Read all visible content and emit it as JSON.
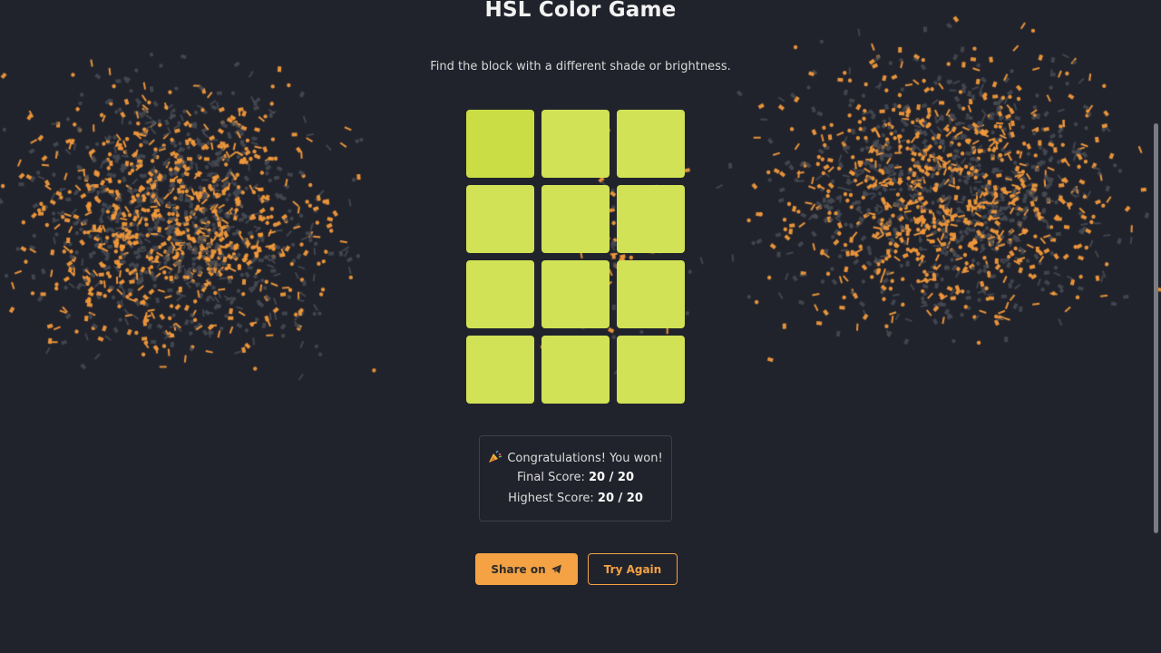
{
  "game": {
    "title": "HSL Color Game",
    "subtitle": "Find the block with a different shade or brightness."
  },
  "grid": {
    "rows": 4,
    "cols": 3,
    "base_color": "#d1e256",
    "odd_color": "#cadd45",
    "odd_index": 0
  },
  "result": {
    "message": "Congratulations! You won!",
    "final_label": "Final Score:",
    "final_value": "20 / 20",
    "highest_label": "Highest Score:",
    "highest_value": "20 / 20",
    "icon": "party-popper-icon"
  },
  "buttons": {
    "share_label": "Share on",
    "share_icon": "telegram-send-icon",
    "try_again_label": "Try Again"
  },
  "colors": {
    "background": "#21232c",
    "accent": "#f4a244",
    "confetti_primary": "#f29a3c",
    "confetti_secondary": "#4a4d55"
  }
}
